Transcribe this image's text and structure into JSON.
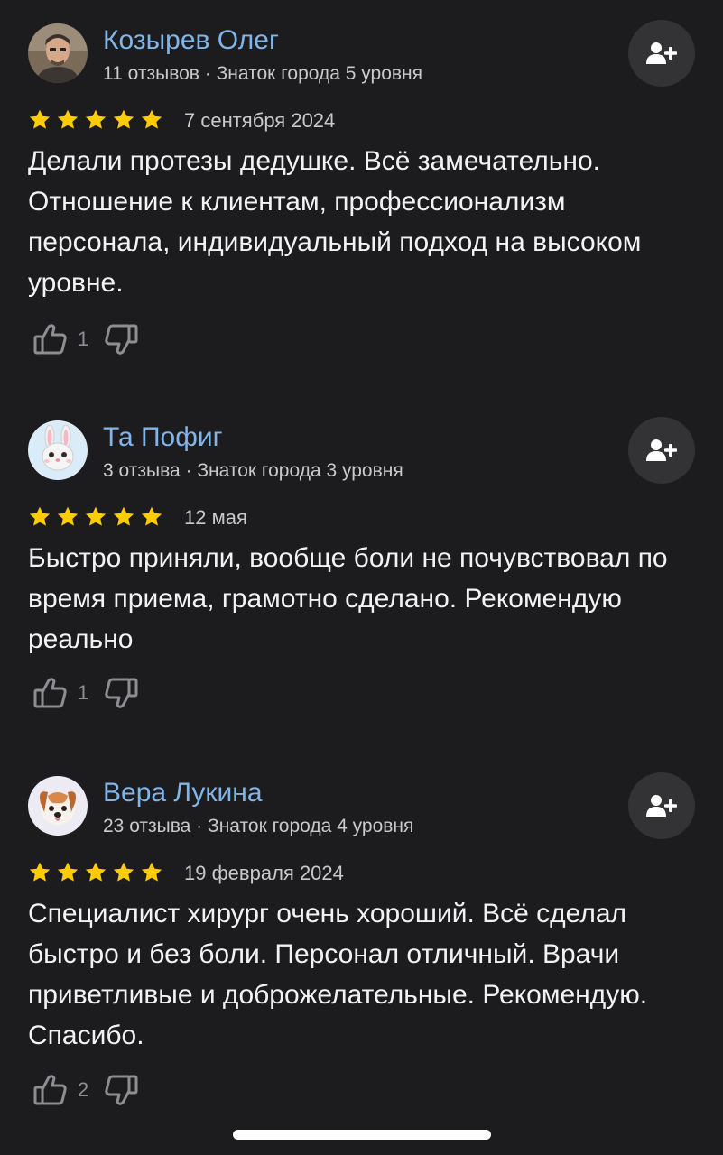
{
  "reviews": [
    {
      "author": "Козырев Олег",
      "meta": "11 отзывов · Знаток города 5 уровня",
      "avatar": "photo-avatar",
      "rating": 5,
      "date": "7 сентября 2024",
      "text": "Делали протезы дедушке. Всё замечательно. Отношение к клиентам, профессионализм персонала, индивидуальный подход на высоком уровне.",
      "likes": "1"
    },
    {
      "author": "Та Пофиг",
      "meta": "3 отзыва · Знаток города 3 уровня",
      "avatar": "bunny-emoji-avatar",
      "rating": 5,
      "date": "12 мая",
      "text": "Быстро приняли, вообще боли не почувствовал по время приема, грамотно сделано. Рекомендую реально",
      "likes": "1"
    },
    {
      "author": "Вера Лукина",
      "meta": "23 отзыва · Знаток города 4 уровня",
      "avatar": "puppy-emoji-avatar",
      "rating": 5,
      "date": "19 февраля 2024",
      "text": "Специалист хирург очень хороший. Всё сделал быстро и без боли. Персонал отличный. Врачи приветливые и доброжелательные. Рекомендую. Спасибо.",
      "likes": "2"
    }
  ],
  "icons": {
    "subscribe": "add-user-icon",
    "like": "thumbs-up-icon",
    "dislike": "thumbs-down-icon",
    "star": "star-icon"
  },
  "colors": {
    "background": "#1c1c1e",
    "author_name": "#7fb5e8",
    "star": "#ffcc00",
    "button_bg": "#333336"
  }
}
